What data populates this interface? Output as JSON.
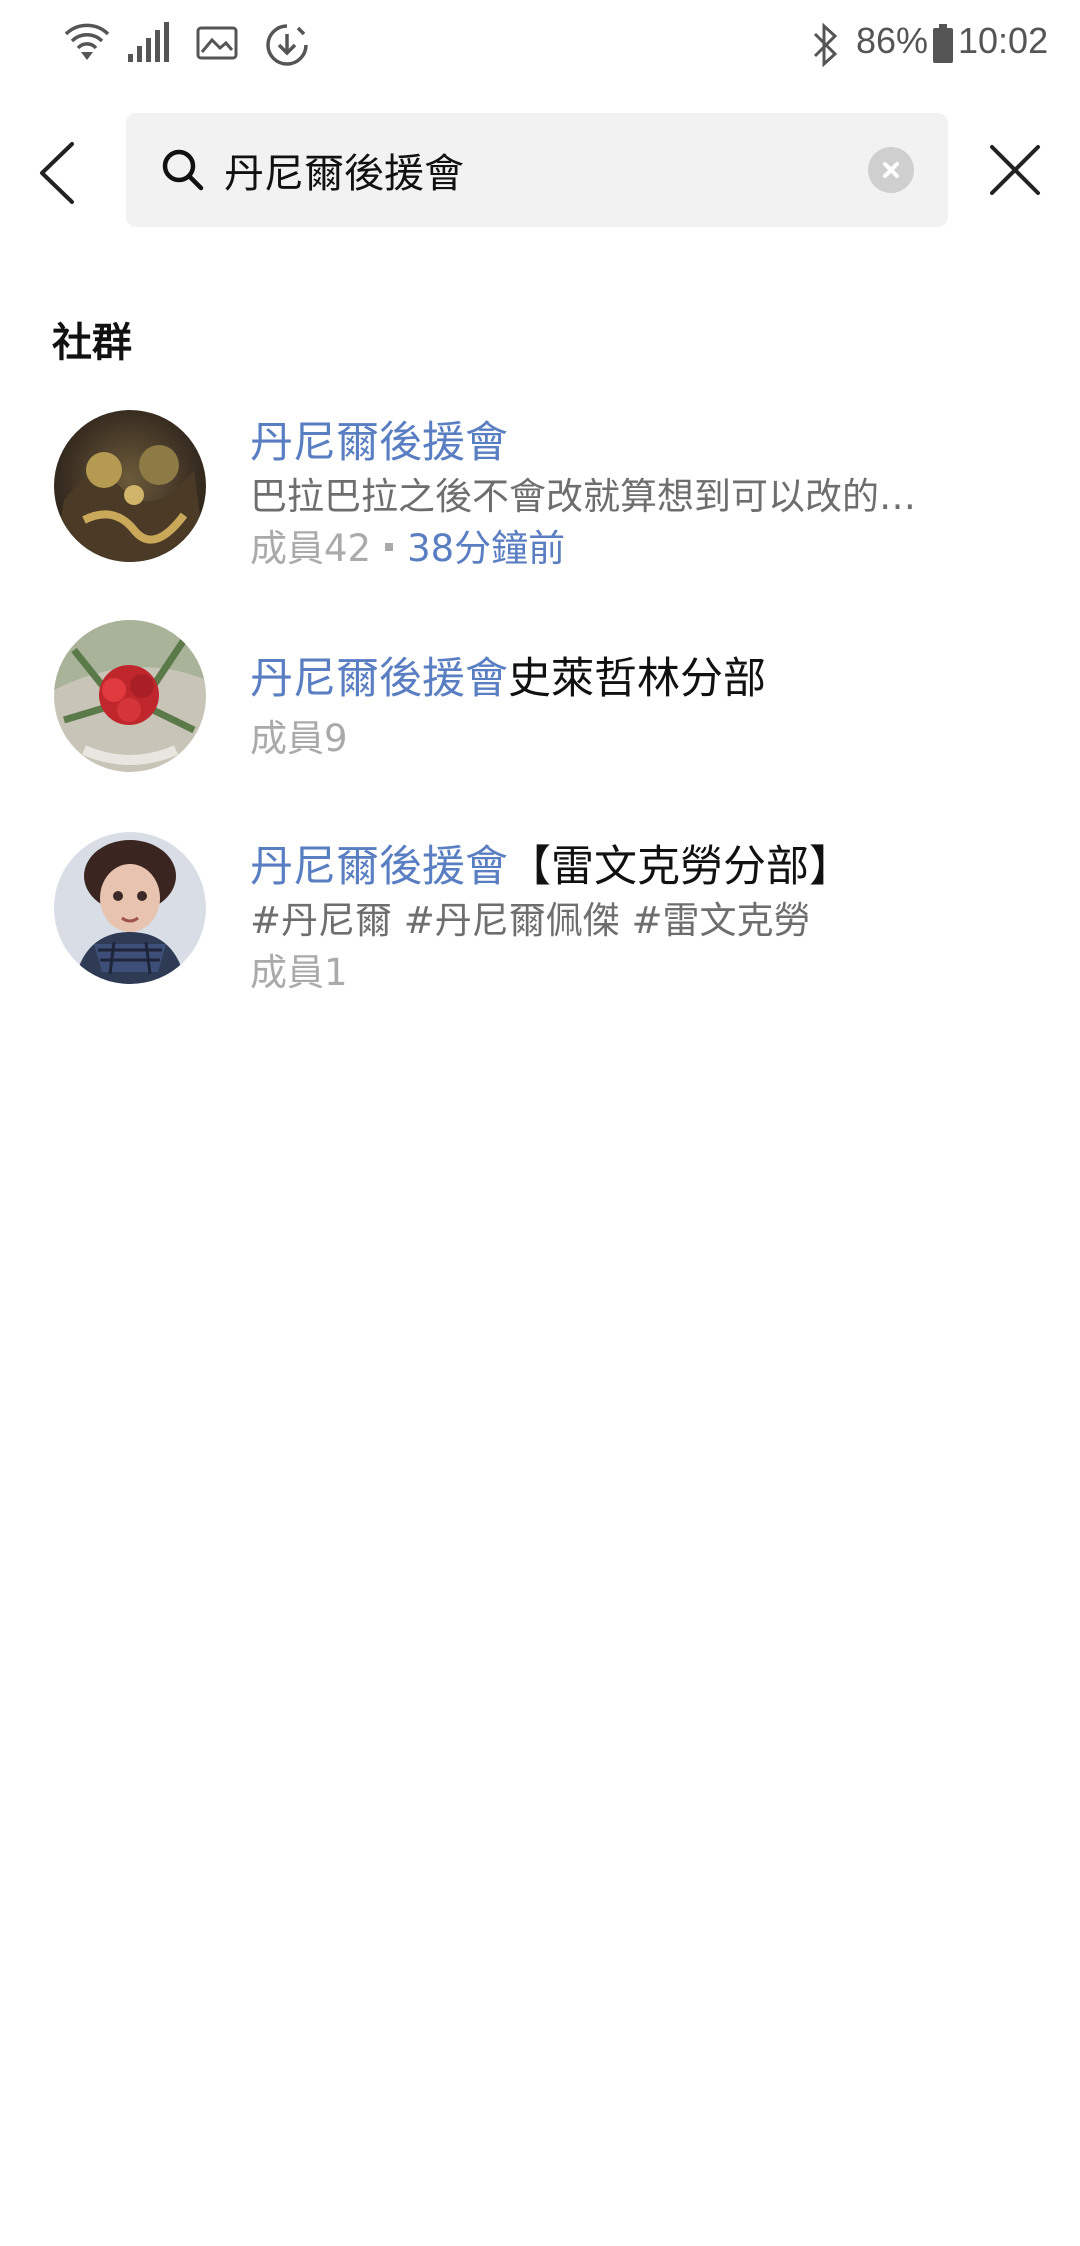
{
  "status_bar": {
    "battery_percent": "86%",
    "time": "10:02",
    "icons": [
      "wifi-icon",
      "signal-icon",
      "gallery-icon",
      "download-icon",
      "bluetooth-icon",
      "battery-icon"
    ]
  },
  "search": {
    "value": "丹尼爾後援會",
    "icons": [
      "back-arrow-icon",
      "search-icon",
      "clear-icon",
      "close-icon"
    ]
  },
  "section": {
    "title": "社群"
  },
  "results": [
    {
      "name_highlight": "丹尼爾後援會",
      "name_rest": "",
      "description": "巴拉巴拉之後不會改就算想到可以改的…",
      "members": "成員42",
      "time": "38分鐘前"
    },
    {
      "name_highlight": "丹尼爾後援會",
      "name_rest": "史萊哲林分部",
      "members": "成員9"
    },
    {
      "name_highlight": "丹尼爾後援會",
      "name_rest": "【雷文克勞分部】",
      "description": "#丹尼爾 #丹尼爾佩傑 #雷文克勞",
      "members": "成員1"
    }
  ],
  "colors": {
    "accent": "#5a7ec2",
    "search_bg": "#f2f2f2",
    "meta_text": "#aaaaaa"
  }
}
